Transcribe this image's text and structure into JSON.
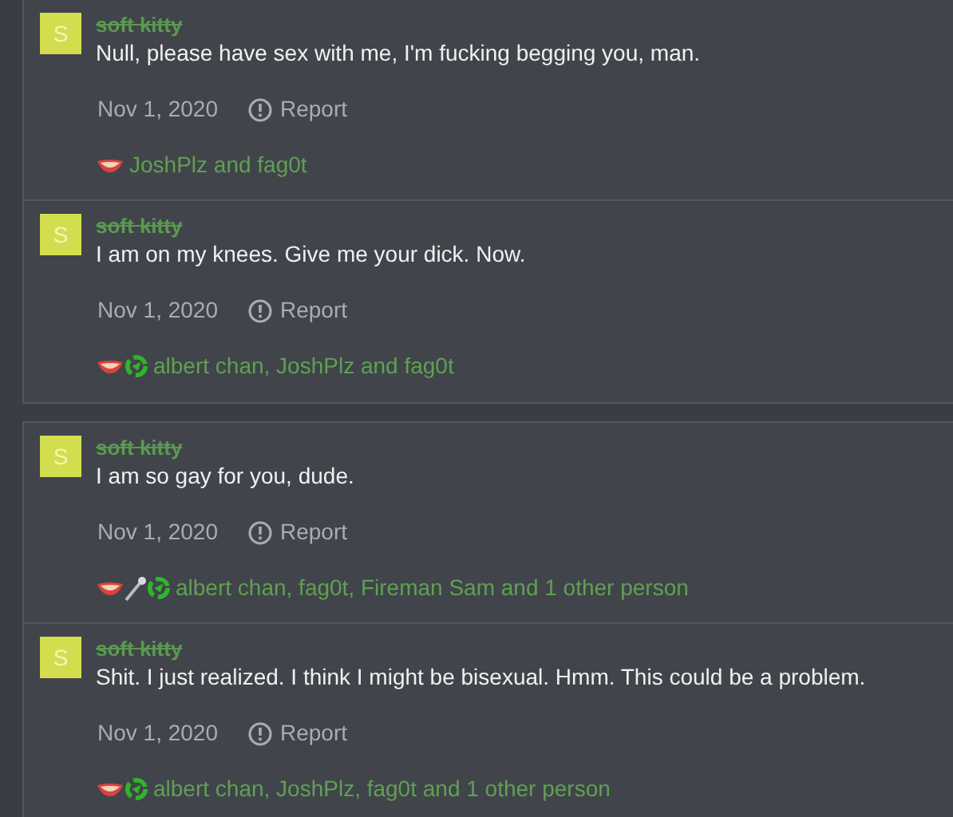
{
  "threads": [
    {
      "comments": [
        {
          "avatar": "S",
          "author": "soft kitty",
          "text": "Null, please have sex with me, I'm fucking begging you, man.",
          "date": "Nov 1, 2020",
          "report": "Report",
          "reactions": [
            {
              "kind": "lips"
            }
          ],
          "reacted_by": "JoshPlz and fag0t"
        },
        {
          "avatar": "S",
          "author": "soft kitty",
          "text": "I am on my knees. Give me your dick. Now.",
          "date": "Nov 1, 2020",
          "report": "Report",
          "reactions": [
            {
              "kind": "lips"
            },
            {
              "kind": "recycle"
            }
          ],
          "reacted_by": "albert chan, JoshPlz and fag0t"
        }
      ]
    },
    {
      "comments": [
        {
          "avatar": "S",
          "author": "soft kitty",
          "text": "I am so gay for you, dude.",
          "date": "Nov 1, 2020",
          "report": "Report",
          "reactions": [
            {
              "kind": "lips"
            },
            {
              "kind": "mic"
            },
            {
              "kind": "recycle"
            }
          ],
          "reacted_by": "albert chan, fag0t, Fireman Sam and 1 other person"
        },
        {
          "avatar": "S",
          "author": "soft kitty",
          "text": "Shit. I just realized. I think I might be bisexual. Hmm. This could be a problem.",
          "date": "Nov 1, 2020",
          "report": "Report",
          "reactions": [
            {
              "kind": "lips"
            },
            {
              "kind": "recycle"
            }
          ],
          "reacted_by": "albert chan, JoshPlz, fag0t and 1 other person"
        }
      ]
    }
  ]
}
